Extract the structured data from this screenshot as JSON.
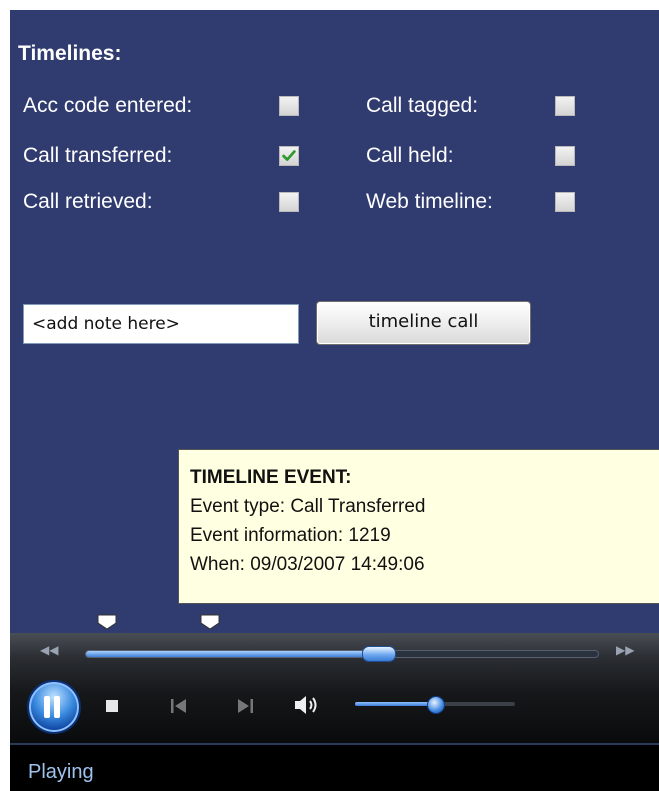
{
  "timelines": {
    "title": "Timelines:",
    "checkboxes": [
      {
        "label": "Acc code entered:",
        "checked": false
      },
      {
        "label": "Call transferred:",
        "checked": true
      },
      {
        "label": "Call retrieved:",
        "checked": false
      },
      {
        "label": "Call tagged:",
        "checked": false
      },
      {
        "label": "Call held:",
        "checked": false
      },
      {
        "label": "Web timeline:",
        "checked": false
      }
    ]
  },
  "note": {
    "value": "<add note here>"
  },
  "timeline_button": {
    "label": "timeline call"
  },
  "tooltip": {
    "heading": "TIMELINE EVENT:",
    "event_type": "Event type: Call Transferred",
    "event_information": "Event information: 1219",
    "when": "When: 09/03/2007 14:49:06"
  },
  "player": {
    "seek_progress": 0.57,
    "volume_level": 0.5,
    "state": "paused-button-shown",
    "icons": {
      "play_pause": "pause-icon",
      "stop": "stop-icon",
      "previous": "previous-track-icon",
      "next": "next-track-icon",
      "volume": "speaker-icon",
      "rewind": "rewind-icon",
      "fast_forward": "fast-forward-icon"
    }
  },
  "status": {
    "text": "Playing"
  },
  "colors": {
    "panel_background": "#303b6f",
    "tooltip_background": "#ffffe1",
    "check_green": "#2e9a2e",
    "status_text": "#9fc3ef"
  }
}
